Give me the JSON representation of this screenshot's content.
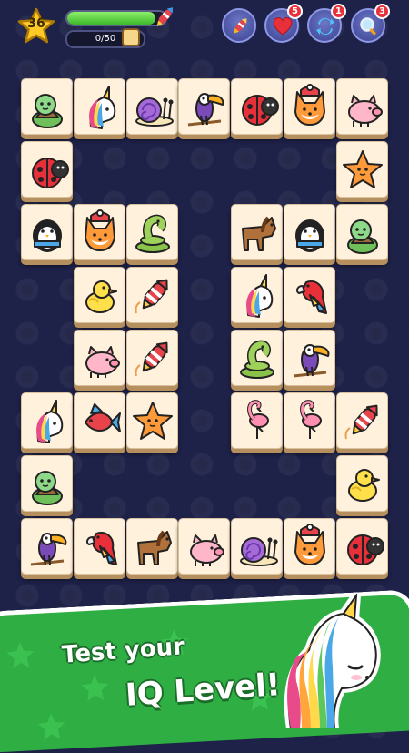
{
  "hud": {
    "level": "36",
    "progress_text": "0/50",
    "progress_fraction": 0.9,
    "powerups": [
      {
        "name": "rocket-icon",
        "count": ""
      },
      {
        "name": "heart-icon",
        "count": "5"
      },
      {
        "name": "shuffle-icon",
        "count": "1"
      },
      {
        "name": "magnifier-icon",
        "count": "3"
      }
    ]
  },
  "board": {
    "tiles": [
      {
        "animal": "turtle"
      },
      {
        "animal": "unicorn"
      },
      {
        "animal": "snail"
      },
      {
        "animal": "toucan"
      },
      {
        "animal": "ladybug"
      },
      {
        "animal": "fox"
      },
      {
        "animal": "pig"
      },
      {
        "animal": "ladybug"
      },
      {
        "animal": "starfish"
      },
      {
        "animal": "penguin"
      },
      {
        "animal": "fox"
      },
      {
        "animal": "snake"
      },
      {
        "animal": "horse"
      },
      {
        "animal": "penguin"
      },
      {
        "animal": "turtle"
      },
      {
        "animal": "chick"
      },
      {
        "animal": "rocket"
      },
      {
        "animal": "unicorn"
      },
      {
        "animal": "parrot"
      },
      {
        "animal": "pig"
      },
      {
        "animal": "rocket"
      },
      {
        "animal": "snake"
      },
      {
        "animal": "toucan"
      },
      {
        "animal": "unicorn"
      },
      {
        "animal": "fish"
      },
      {
        "animal": "starfish"
      },
      {
        "animal": "flamingo"
      },
      {
        "animal": "flamingo"
      },
      {
        "animal": "rocket"
      },
      {
        "animal": "turtle"
      },
      {
        "animal": "chick"
      },
      {
        "animal": "toucan"
      },
      {
        "animal": "parrot"
      },
      {
        "animal": "horse"
      },
      {
        "animal": "pig"
      },
      {
        "animal": "snail"
      },
      {
        "animal": "fox"
      },
      {
        "animal": "ladybug"
      }
    ]
  },
  "banner": {
    "line1": "Test your",
    "line2": "IQ Level!"
  },
  "colors": {
    "background": "#1e2148",
    "tile": "#fff1dc",
    "banner": "#2fae43",
    "badge": "#e8303a"
  }
}
